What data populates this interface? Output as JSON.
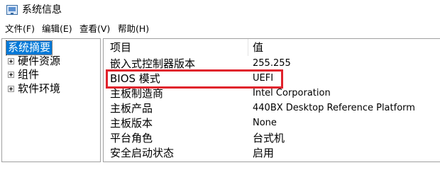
{
  "window": {
    "title": "系统信息"
  },
  "menu": [
    {
      "label": "文件(F)"
    },
    {
      "label": "编辑(E)"
    },
    {
      "label": "查看(V)"
    },
    {
      "label": "帮助(H)"
    }
  ],
  "tree": {
    "root": "系统摘要",
    "nodes": [
      {
        "label": "硬件资源"
      },
      {
        "label": "组件"
      },
      {
        "label": "软件环境"
      }
    ]
  },
  "table": {
    "headers": {
      "item": "项目",
      "value": "值"
    },
    "rows": [
      {
        "item": "嵌入式控制器版本",
        "value": "255.255"
      },
      {
        "item": "BIOS 模式",
        "value": "UEFI"
      },
      {
        "item": "主板制造商",
        "value": "Intel Corporation"
      },
      {
        "item": "主板产品",
        "value": "440BX Desktop Reference Platform"
      },
      {
        "item": "主板版本",
        "value": "None"
      },
      {
        "item": "平台角色",
        "value": "台式机"
      },
      {
        "item": "安全启动状态",
        "value": "启用"
      }
    ]
  },
  "colors": {
    "selection": "#0078d7",
    "highlight_border": "#e0222c"
  },
  "icons": {
    "app": "system-information-icon",
    "expander": "plus-expander-icon"
  }
}
